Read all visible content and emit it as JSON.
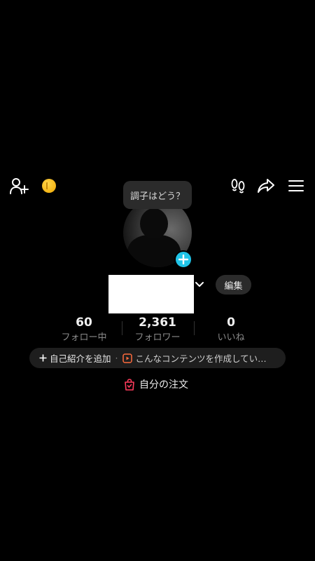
{
  "header": {
    "add_friend_icon": "person-plus-icon",
    "coin_icon": "coin-icon",
    "footprints_icon": "footprints-icon",
    "share_icon": "share-arrow-icon",
    "menu_icon": "hamburger-menu-icon"
  },
  "status_bubble": {
    "text": "調子はどう？"
  },
  "profile": {
    "edit_label": "編集",
    "plus_badge": "+"
  },
  "stats": [
    {
      "value": "60",
      "label": "フォロー中"
    },
    {
      "value": "2,361",
      "label": "フォロワー"
    },
    {
      "value": "0",
      "label": "いいね"
    }
  ],
  "bio": {
    "add_bio_label": "自己紹介を追加",
    "separator": "·",
    "content_hint": "こんなコンテンツを作成してい…"
  },
  "orders": {
    "label": "自分の注文"
  },
  "colors": {
    "accent_cyan": "#20c4e8",
    "order_icon_red": "#ff3b5c",
    "coin_gold": "#f5b800"
  }
}
